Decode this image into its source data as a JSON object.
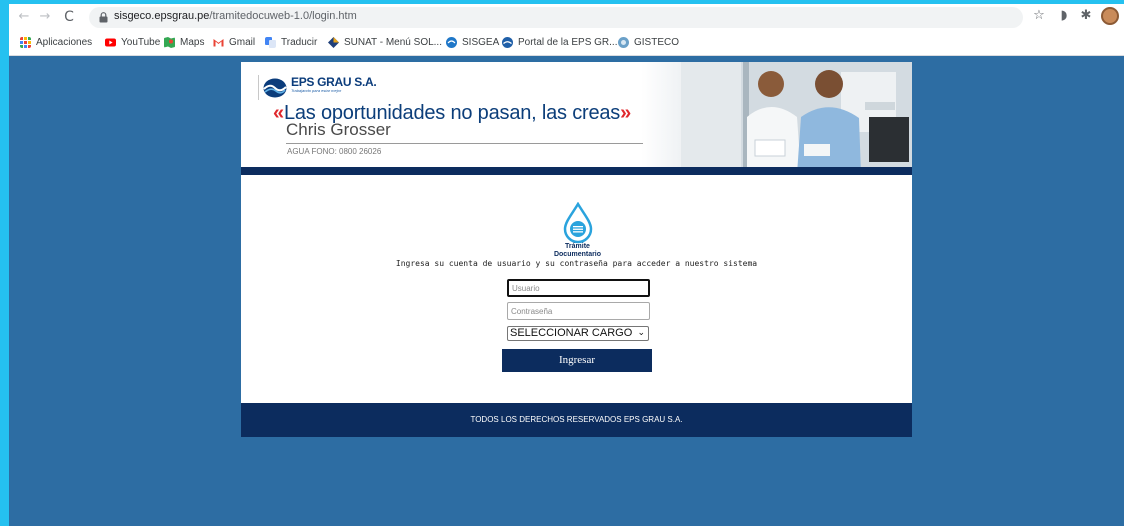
{
  "browser": {
    "url_host": "sisgeco.epsgrau.pe",
    "url_path": "/tramitedocuweb-1.0/login.htm",
    "nav": {
      "back": "←",
      "forward": "→",
      "reload": "C"
    },
    "icons": {
      "star": "☆",
      "ext1": "◗",
      "ext2": "✱"
    },
    "bookmarks": [
      {
        "label": "Aplicaciones",
        "icon": "apps-grid-icon",
        "color": "#ea4335"
      },
      {
        "label": "YouTube",
        "icon": "youtube-icon",
        "color": "#ff0000"
      },
      {
        "label": "Maps",
        "icon": "maps-icon",
        "color": "#34a853"
      },
      {
        "label": "Gmail",
        "icon": "gmail-icon",
        "color": "#ea4335"
      },
      {
        "label": "Traducir",
        "icon": "translate-icon",
        "color": "#4285f4"
      },
      {
        "label": "SUNAT - Menú SOL...",
        "icon": "sunat-icon",
        "color": "#e8a317"
      },
      {
        "label": "SISGEA",
        "icon": "sisgea-icon",
        "color": "#1f77c8"
      },
      {
        "label": "Portal de la EPS GR...",
        "icon": "eps-icon",
        "color": "#1f5fa8"
      },
      {
        "label": "GISTECO",
        "icon": "gisteco-icon",
        "color": "#6aa0c8"
      }
    ]
  },
  "banner": {
    "logo_name": "EPS GRAU S.A.",
    "logo_tagline": "Trabajando para estar mejor",
    "quote_open": "«",
    "quote_text": "Las oportunidades no pasan, las creas",
    "quote_close": "»",
    "author": "Chris Grosser",
    "phone": "AGUA FONO: 0800 26026"
  },
  "login": {
    "app_name_line1": "Trámite",
    "app_name_line2": "Documentario",
    "intro": "Ingresa su cuenta de usuario y su contraseña para acceder a nuestro sistema",
    "username_placeholder": "Usuario",
    "password_placeholder": "Contraseña",
    "role_selected": "SELECCIONAR CARGO",
    "submit_label": "Ingresar"
  },
  "footer": {
    "text": "TODOS LOS DERECHOS RESERVADOS EPS GRAU S.A."
  },
  "colors": {
    "page_background": "#2d6da3",
    "frame_accent": "#25c1f0",
    "brand_navy": "#0c2c5e",
    "quote_red": "#e0282d"
  }
}
